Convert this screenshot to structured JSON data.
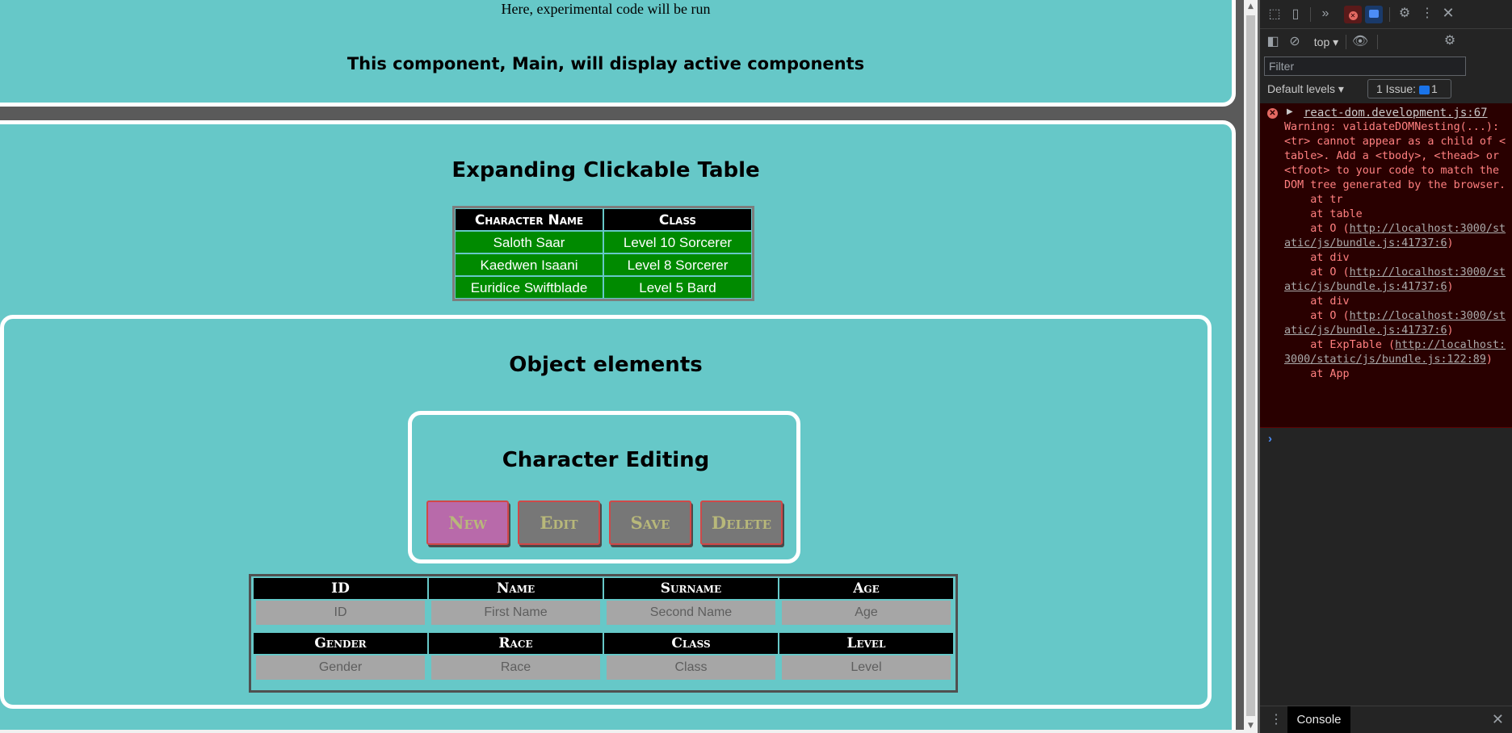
{
  "page": {
    "experimental_text": "Here, experimental code will be run",
    "main_text": "This component, Main, will display active components",
    "exp_table_title": "Expanding Clickable Table",
    "exp_table": {
      "headers": [
        "Character Name",
        "Class"
      ],
      "rows": [
        [
          "Saloth Saar",
          "Level 10 Sorcerer"
        ],
        [
          "Kaedwen Isaani",
          "Level 8 Sorcerer"
        ],
        [
          "Euridice Swiftblade",
          "Level 5 Bard"
        ]
      ]
    },
    "object_title": "Object elements",
    "editing_title": "Character Editing",
    "buttons": {
      "new": "New",
      "edit": "Edit",
      "save": "Save",
      "delete": "Delete"
    },
    "form": {
      "row1_headers": [
        "ID",
        "Name",
        "Surname",
        "Age"
      ],
      "row1_placeholders": [
        "ID",
        "First Name",
        "Second Name",
        "Age"
      ],
      "row2_headers": [
        "Gender",
        "Race",
        "Class",
        "Level"
      ],
      "row2_placeholders": [
        "Gender",
        "Race",
        "Class",
        "Level"
      ]
    }
  },
  "devtools": {
    "context": "top",
    "filter_placeholder": "Filter",
    "levels": "Default levels",
    "issues_label": "1 Issue:",
    "issues_count": "1",
    "error_source": "react-dom.development.js:67",
    "error_lines": [
      "Warning: validateDOMNesting(...): <tr> cannot appear as a child of <table>. Add a <tbody>, <thead> or <tfoot> to your code to match the DOM tree generated by the browser.",
      "    at tr",
      "    at table"
    ],
    "stack": [
      {
        "prefix": "    at O (",
        "link": "http://localhost:3000/static/js/bundle.js:41737:6",
        "suffix": ")"
      },
      {
        "prefix": "    at div",
        "link": "",
        "suffix": ""
      },
      {
        "prefix": "    at O (",
        "link": "http://localhost:3000/static/js/bundle.js:41737:6",
        "suffix": ")"
      },
      {
        "prefix": "    at div",
        "link": "",
        "suffix": ""
      },
      {
        "prefix": "    at O (",
        "link": "http://localhost:3000/static/js/bundle.js:41737:6",
        "suffix": ")"
      },
      {
        "prefix": "    at ExpTable (",
        "link": "http://localhost:3000/static/js/bundle.js:122:89",
        "suffix": ")"
      },
      {
        "prefix": "    at App",
        "link": "",
        "suffix": ""
      }
    ],
    "prompt": "›",
    "drawer_tab": "Console",
    "icons": {
      "inspect": "inspect-element-icon",
      "device": "device-toolbar-icon",
      "more_tabs": "more-tabs-icon",
      "errors": "error-count-icon",
      "messages": "message-count-icon",
      "settings": "settings-gear-icon",
      "menu": "kebab-menu-icon",
      "close": "close-icon",
      "sidebar": "sidebar-toggle-icon",
      "clear": "clear-console-icon",
      "eye": "live-expression-icon"
    }
  },
  "colors": {
    "panel_bg": "#66c8c8",
    "table_row_bg": "#008a00",
    "new_button": "#b86aaa",
    "button_bg": "#777777",
    "button_text": "#b8b87a",
    "error_bg": "#290000",
    "error_text": "#ff8080"
  }
}
